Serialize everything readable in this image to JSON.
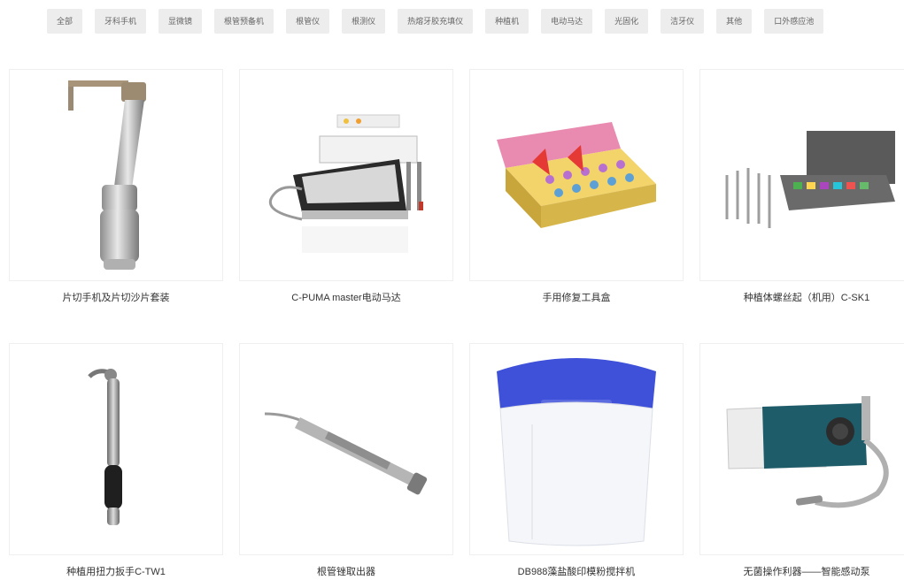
{
  "filter_tabs": [
    {
      "label": "全部"
    },
    {
      "label": "牙科手机"
    },
    {
      "label": "显微镜"
    },
    {
      "label": "根管预备机"
    },
    {
      "label": "根管仪"
    },
    {
      "label": "根测仪"
    },
    {
      "label": "热熔牙胶充填仪"
    },
    {
      "label": "种植机"
    },
    {
      "label": "电动马达"
    },
    {
      "label": "光固化"
    },
    {
      "label": "洁牙仪"
    },
    {
      "label": "其他"
    },
    {
      "label": "口外感应池"
    }
  ],
  "products": [
    {
      "title": "片切手机及片切沙片套装",
      "icon": "contra-angle-handpiece-icon"
    },
    {
      "title": "C-PUMA master电动马达",
      "icon": "electric-motor-unit-icon"
    },
    {
      "title": "手用修复工具盒",
      "icon": "restoration-tool-box-icon"
    },
    {
      "title": "种植体螺丝起（机用）C-SK1",
      "icon": "implant-screwdriver-kit-icon"
    },
    {
      "title": "种植用扭力扳手C-TW1",
      "icon": "torque-wrench-icon"
    },
    {
      "title": "根管锉取出器",
      "icon": "file-extractor-icon"
    },
    {
      "title": "DB988藻盐酸印模粉搅拌机",
      "icon": "alginate-mixer-icon"
    },
    {
      "title": "无菌操作利器——智能感动泵",
      "icon": "smart-pump-icon"
    }
  ],
  "colors": {
    "tab_bg": "#ededed",
    "tab_text": "#666666",
    "caption_text": "#333333",
    "card_border": "#efefef"
  }
}
